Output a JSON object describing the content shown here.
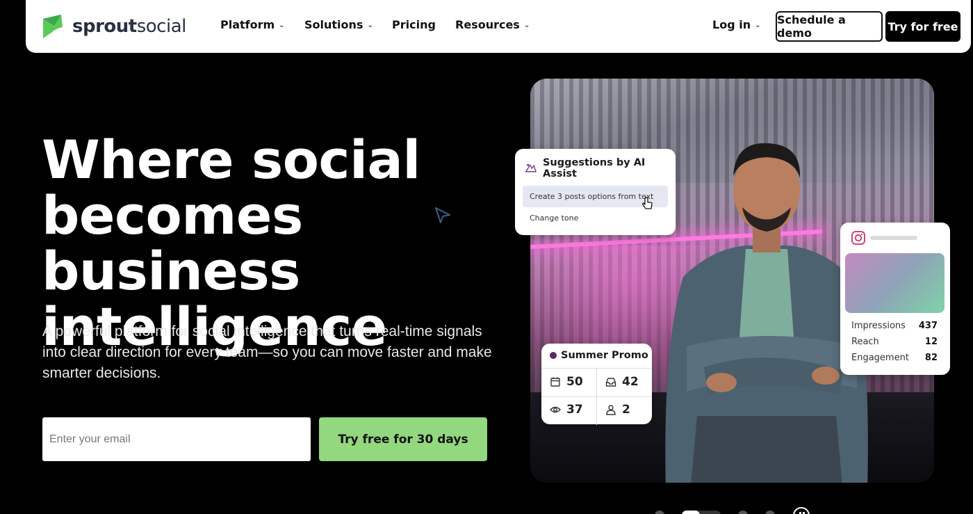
{
  "brand": {
    "name_bold": "sprout",
    "name_light": "social",
    "color": "#59cb59"
  },
  "nav": {
    "items": [
      {
        "label": "Platform",
        "has_chevron": true
      },
      {
        "label": "Solutions",
        "has_chevron": true
      },
      {
        "label": "Pricing",
        "has_chevron": false
      },
      {
        "label": "Resources",
        "has_chevron": true
      }
    ],
    "login": "Log in",
    "schedule_demo": "Schedule a demo",
    "try_free": "Try for free"
  },
  "hero": {
    "title_line1": "Where social",
    "title_line2": "becomes business",
    "title_line3": "intelligence",
    "subtitle": "A powerful platform for social intelligence that turns real-time signals into clear direction for every team—so you can move faster and make smarter decisions.",
    "email_placeholder": "Enter your email",
    "cta": "Try free for 30 days",
    "cta_color": "#93d77e"
  },
  "ai_card": {
    "title": "Suggestions by AI Assist",
    "option1": "Create 3 posts options from text",
    "option2": "Change tone"
  },
  "ig_card": {
    "metrics": [
      {
        "label": "Impressions",
        "value": "437"
      },
      {
        "label": "Reach",
        "value": "12"
      },
      {
        "label": "Engagement",
        "value": "82"
      }
    ]
  },
  "promo_card": {
    "title": "Summer Promo",
    "stats": [
      {
        "icon": "calendar-icon",
        "value": "50"
      },
      {
        "icon": "inbox-icon",
        "value": "42"
      },
      {
        "icon": "eye-icon",
        "value": "37"
      },
      {
        "icon": "user-icon",
        "value": "2"
      }
    ]
  },
  "carousel": {
    "slides": 4,
    "active": 2
  }
}
